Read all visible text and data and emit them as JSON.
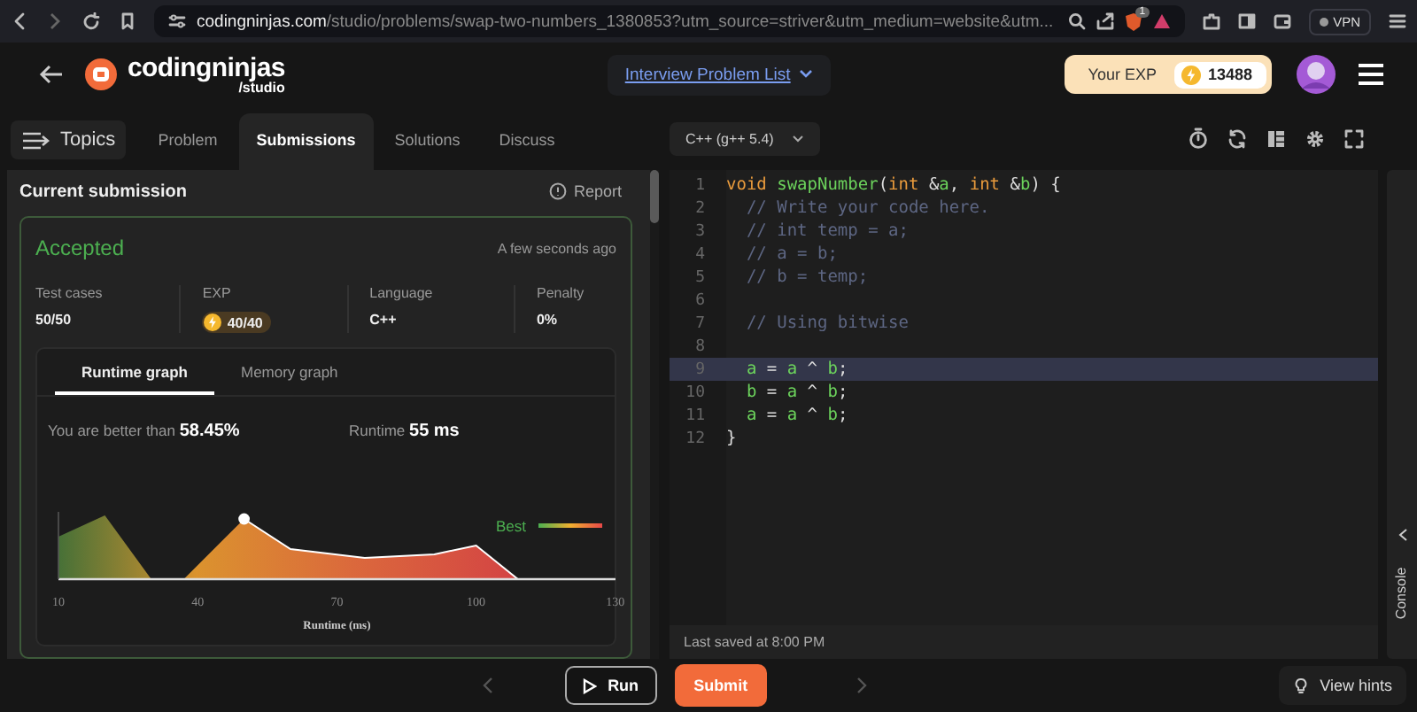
{
  "browser": {
    "url": {
      "host": "codingninjas.com",
      "path": "/studio/problems/swap-two-numbers_1380853?utm_source=striver&utm_medium=website&utm..."
    },
    "extension_badge": "1",
    "vpn": "VPN"
  },
  "header": {
    "brand": "codingninjas",
    "brand_sub": "/studio",
    "problem_list": "Interview Problem List",
    "exp_label": "Your EXP",
    "exp_value": "13488"
  },
  "topics_button": "Topics",
  "tabs": [
    {
      "label": "Problem",
      "selected": false
    },
    {
      "label": "Submissions",
      "selected": true
    },
    {
      "label": "Solutions",
      "selected": false
    },
    {
      "label": "Discuss",
      "selected": false
    }
  ],
  "submission": {
    "title": "Current submission",
    "report": "Report",
    "status": "Accepted",
    "time": "A few seconds ago",
    "stats": [
      {
        "label": "Test cases",
        "value": "50/50",
        "kind": "text"
      },
      {
        "label": "EXP",
        "value": "40/40",
        "kind": "exp"
      },
      {
        "label": "Language",
        "value": "C++",
        "kind": "text"
      },
      {
        "label": "Penalty",
        "value": "0%",
        "kind": "text"
      }
    ]
  },
  "graph": {
    "tabs": [
      {
        "label": "Runtime graph",
        "selected": true
      },
      {
        "label": "Memory graph",
        "selected": false
      }
    ],
    "better_than": "You are better than **58.45%**",
    "runtime": "Runtime **55 ms**",
    "legend": "Best",
    "xticks": [
      "10",
      "40",
      "70",
      "100",
      "130"
    ],
    "xlabel": "Runtime (ms)"
  },
  "editor": {
    "language": "C++ (g++ 5.4)",
    "lines": [
      {
        "number": "1",
        "highlighted": false,
        "tokens": [
          {
            "text": "void",
            "kind": "keyword"
          },
          {
            "text": " swapNumber",
            "kind": "function"
          },
          {
            "text": "(",
            "kind": "plain"
          },
          {
            "text": "int",
            "kind": "keyword"
          },
          {
            "text": " &",
            "kind": "plain"
          },
          {
            "text": "a",
            "kind": "variable"
          },
          {
            "text": ", ",
            "kind": "plain"
          },
          {
            "text": "int",
            "kind": "keyword"
          },
          {
            "text": " &",
            "kind": "plain"
          },
          {
            "text": "b",
            "kind": "variable"
          },
          {
            "text": ") {",
            "kind": "plain"
          }
        ]
      },
      {
        "number": "2",
        "highlighted": false,
        "tokens": [
          {
            "text": "  // Write your code here.",
            "kind": "comment"
          }
        ]
      },
      {
        "number": "3",
        "highlighted": false,
        "tokens": [
          {
            "text": "  // int temp = a;",
            "kind": "comment"
          }
        ]
      },
      {
        "number": "4",
        "highlighted": false,
        "tokens": [
          {
            "text": "  // a = b;",
            "kind": "comment"
          }
        ]
      },
      {
        "number": "5",
        "highlighted": false,
        "tokens": [
          {
            "text": "  // b = temp;",
            "kind": "comment"
          }
        ]
      },
      {
        "number": "6",
        "highlighted": false
      },
      {
        "number": "7",
        "highlighted": false,
        "tokens": [
          {
            "text": "  // Using bitwise",
            "kind": "comment"
          }
        ]
      },
      {
        "number": "8",
        "highlighted": false
      },
      {
        "number": "9",
        "highlighted": true,
        "tokens": [
          {
            "text": "  a",
            "kind": "variable"
          },
          {
            "text": " = ",
            "kind": "plain"
          },
          {
            "text": "a",
            "kind": "variable"
          },
          {
            "text": " ^ ",
            "kind": "plain"
          },
          {
            "text": "b",
            "kind": "variable"
          },
          {
            "text": ";",
            "kind": "plain"
          }
        ]
      },
      {
        "number": "10",
        "highlighted": false,
        "tokens": [
          {
            "text": "  b",
            "kind": "variable"
          },
          {
            "text": " = ",
            "kind": "plain"
          },
          {
            "text": "a",
            "kind": "variable"
          },
          {
            "text": " ^ ",
            "kind": "plain"
          },
          {
            "text": "b",
            "kind": "variable"
          },
          {
            "text": ";",
            "kind": "plain"
          }
        ]
      },
      {
        "number": "11",
        "highlighted": false,
        "tokens": [
          {
            "text": "  a",
            "kind": "variable"
          },
          {
            "text": " = ",
            "kind": "plain"
          },
          {
            "text": "a",
            "kind": "variable"
          },
          {
            "text": " ^ ",
            "kind": "plain"
          },
          {
            "text": "b",
            "kind": "variable"
          },
          {
            "text": ";",
            "kind": "plain"
          }
        ]
      },
      {
        "number": "12",
        "highlighted": false,
        "tokens": [
          {
            "text": "}",
            "kind": "plain"
          }
        ]
      }
    ],
    "last_saved": "Last saved at 8:00 PM",
    "console": "Console"
  },
  "footer": {
    "run": "Run",
    "submit": "Submit",
    "hints": "View hints"
  }
}
